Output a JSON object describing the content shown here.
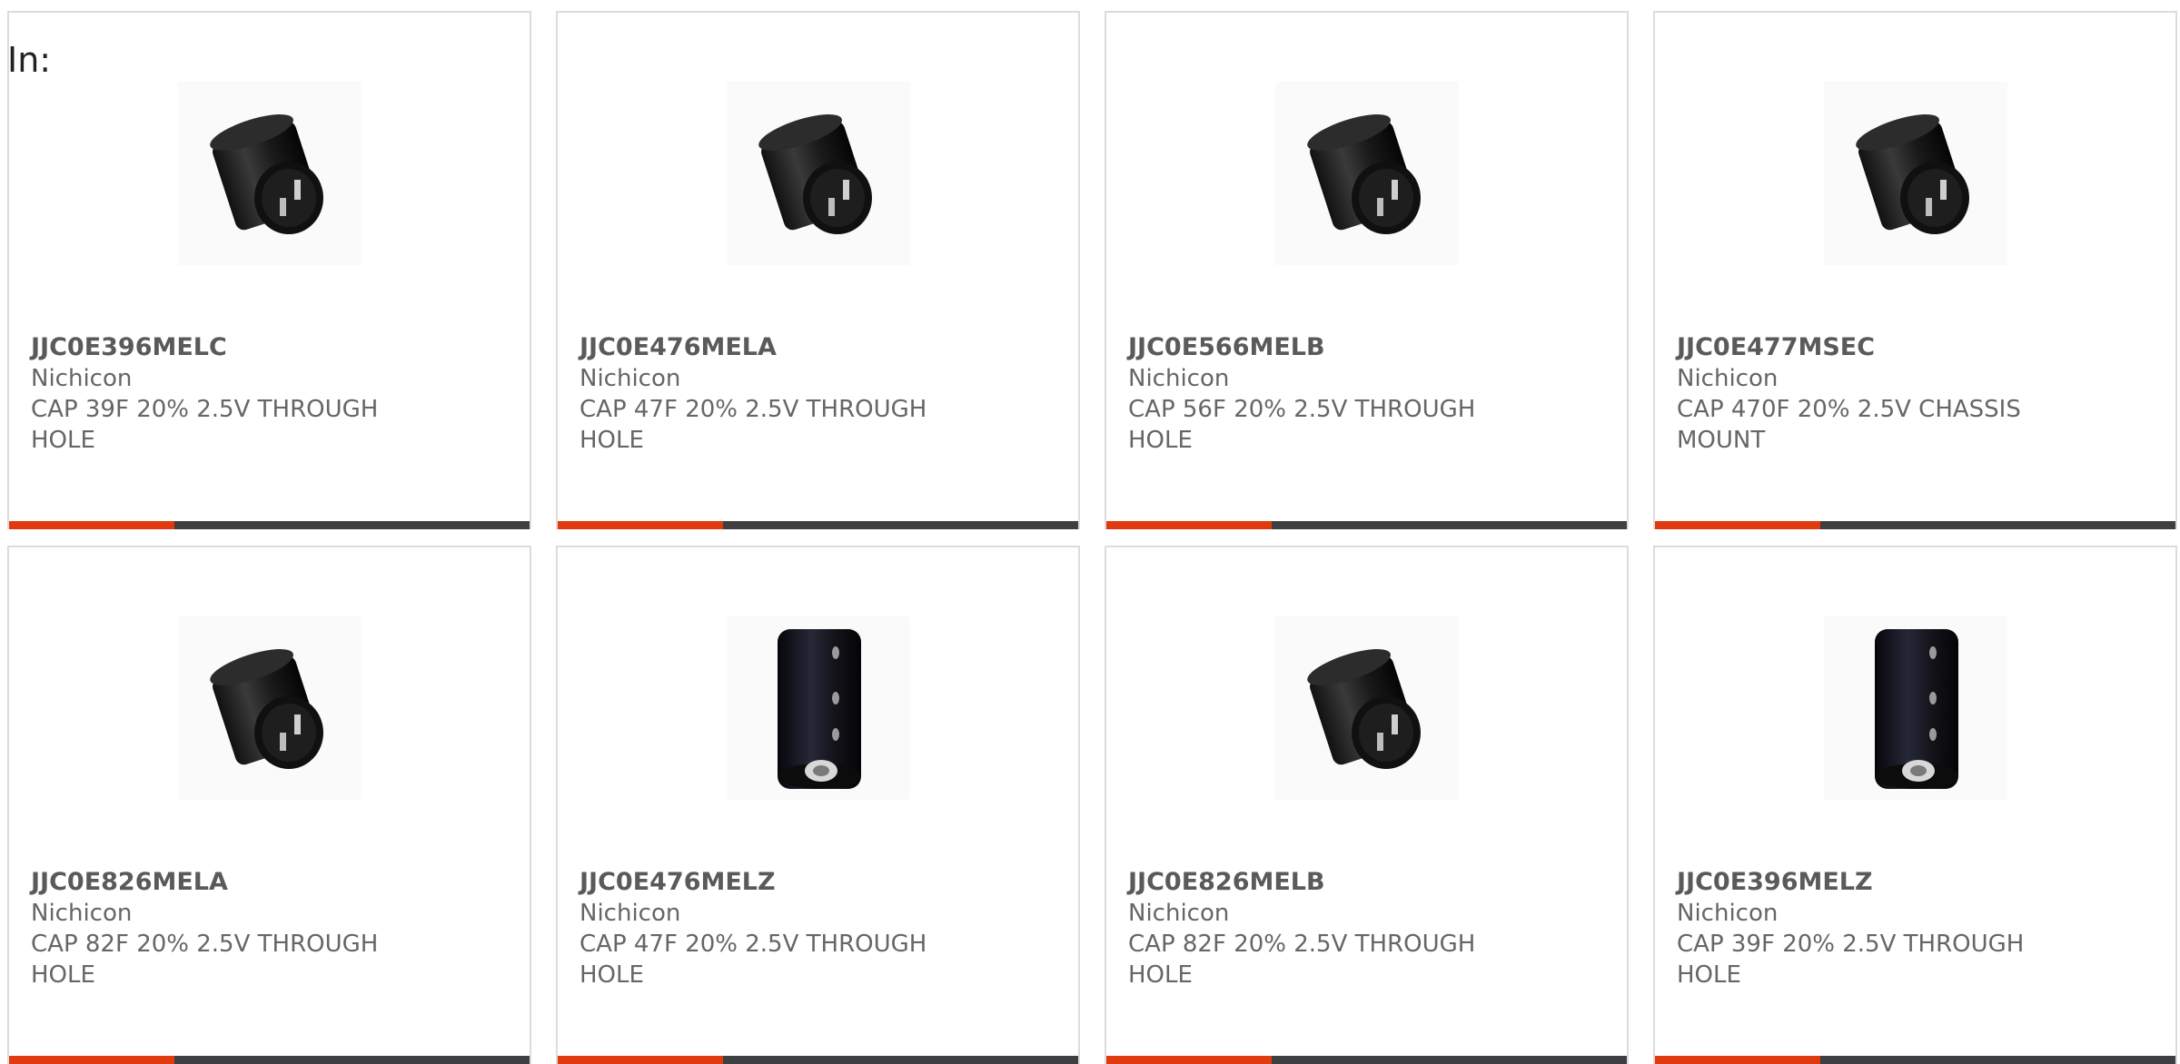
{
  "filter": {
    "label": "In:"
  },
  "colors": {
    "accent": "#e03a0e",
    "bar_dark": "#3d3f40",
    "card_border": "#dcdcdc",
    "text": "#666666"
  },
  "products": [
    {
      "part_number": "JJC0E396MELC",
      "manufacturer": "Nichicon",
      "description": "CAP 39F 20% 2.5V THROUGH HOLE",
      "image": "capacitor-angled-icon"
    },
    {
      "part_number": "JJC0E476MELA",
      "manufacturer": "Nichicon",
      "description": "CAP 47F 20% 2.5V THROUGH HOLE",
      "image": "capacitor-angled-icon"
    },
    {
      "part_number": "JJC0E566MELB",
      "manufacturer": "Nichicon",
      "description": "CAP 56F 20% 2.5V THROUGH HOLE",
      "image": "capacitor-angled-icon"
    },
    {
      "part_number": "JJC0E477MSEC",
      "manufacturer": "Nichicon",
      "description": "CAP 470F 20% 2.5V CHASSIS MOUNT",
      "image": "capacitor-angled-icon"
    },
    {
      "part_number": "JJC0E826MELA",
      "manufacturer": "Nichicon",
      "description": "CAP 82F 20% 2.5V THROUGH HOLE",
      "image": "capacitor-angled-icon"
    },
    {
      "part_number": "JJC0E476MELZ",
      "manufacturer": "Nichicon",
      "description": "CAP 47F 20% 2.5V THROUGH HOLE",
      "image": "capacitor-tall-icon"
    },
    {
      "part_number": "JJC0E826MELB",
      "manufacturer": "Nichicon",
      "description": "CAP 82F 20% 2.5V THROUGH HOLE",
      "image": "capacitor-angled-icon"
    },
    {
      "part_number": "JJC0E396MELZ",
      "manufacturer": "Nichicon",
      "description": "CAP 39F 20% 2.5V THROUGH HOLE",
      "image": "capacitor-tall-icon"
    }
  ]
}
